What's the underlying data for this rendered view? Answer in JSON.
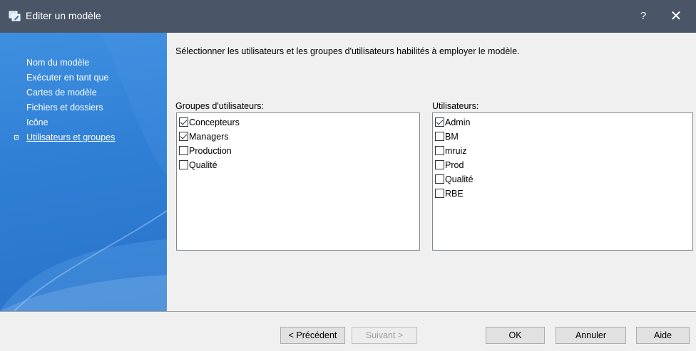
{
  "window": {
    "title": "Editer un modèle",
    "help_label": "?",
    "close_label": "✕",
    "icon": "template-edit-icon"
  },
  "sidebar": {
    "items": [
      {
        "label": "Nom du modèle",
        "active": false
      },
      {
        "label": "Exécuter en tant que",
        "active": false
      },
      {
        "label": "Cartes de modèle",
        "active": false
      },
      {
        "label": "Fichiers et dossiers",
        "active": false
      },
      {
        "label": "Icône",
        "active": false
      },
      {
        "label": "Utilisateurs et groupes",
        "active": true
      }
    ]
  },
  "main": {
    "instruction": "Sélectionner les utilisateurs et les groupes d'utilisateurs habilités à employer le modèle.",
    "groups": {
      "label": "Groupes d'utilisateurs:",
      "items": [
        {
          "label": "Concepteurs",
          "checked": true
        },
        {
          "label": "Managers",
          "checked": true
        },
        {
          "label": "Production",
          "checked": false
        },
        {
          "label": "Qualité",
          "checked": false
        }
      ]
    },
    "users": {
      "label": "Utilisateurs:",
      "items": [
        {
          "label": "Admin",
          "checked": true
        },
        {
          "label": "BM",
          "checked": false
        },
        {
          "label": "mruiz",
          "checked": false
        },
        {
          "label": "Prod",
          "checked": false
        },
        {
          "label": "Qualité",
          "checked": false
        },
        {
          "label": "RBE",
          "checked": false
        }
      ]
    }
  },
  "footer": {
    "previous_label": "< Précédent",
    "next_label": "Suivant >",
    "ok_label": "OK",
    "cancel_label": "Annuler",
    "help_label": "Aide"
  },
  "colors": {
    "titlebar": "#4a5668",
    "sidebar": "#2f7fd6",
    "window_bg": "#f0f0f0"
  }
}
